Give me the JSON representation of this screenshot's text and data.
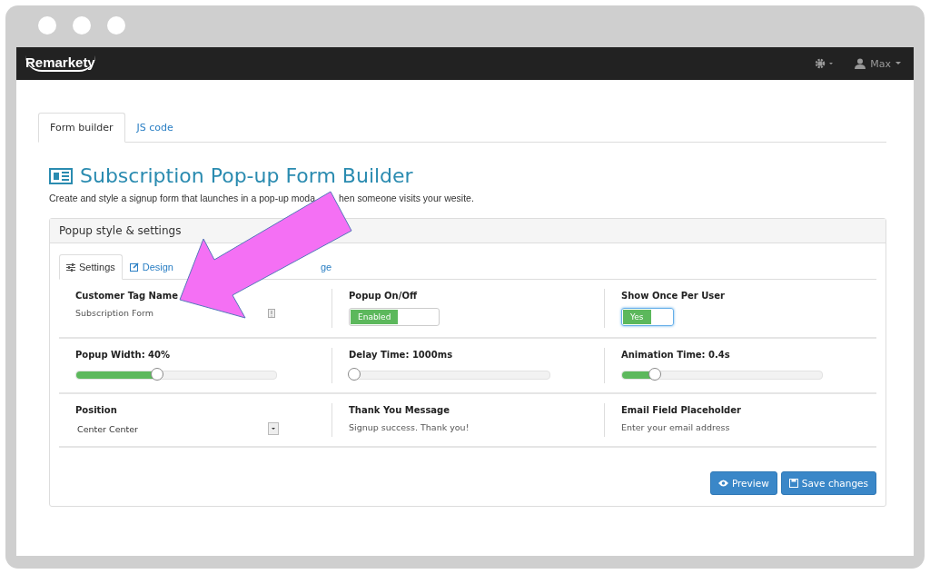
{
  "navbar": {
    "brand": "Remarkety",
    "user": "Max"
  },
  "tabs": [
    {
      "label": "Form builder",
      "selected": true
    },
    {
      "label": "JS code",
      "selected": false
    }
  ],
  "page": {
    "title": "Subscription Pop-up Form Builder",
    "subtitle_start": "Create and style a signup form that launches in a pop-up moda",
    "subtitle_end": "hen someone visits your wesite."
  },
  "panel": {
    "title": "Popup style & settings",
    "tabs": [
      {
        "label": "Settings",
        "selected": true
      },
      {
        "label": "Design",
        "selected": false
      },
      {
        "label": "ge",
        "selected": false
      }
    ],
    "rows": [
      [
        {
          "kind": "text",
          "label": "Customer Tag Name",
          "value": "Subscription Form"
        },
        {
          "kind": "toggle",
          "label": "Popup On/Off",
          "value": "Enabled",
          "on": true
        },
        {
          "kind": "toggle",
          "label": "Show Once Per User",
          "value": "Yes",
          "on": true
        }
      ],
      [
        {
          "kind": "slider",
          "label": "Popup Width: 40%",
          "level": 0.4
        },
        {
          "kind": "slider",
          "label": "Delay Time: 1000ms",
          "level": 0.02
        },
        {
          "kind": "slider",
          "label": "Animation Time: 0.4s",
          "level": 0.16
        }
      ],
      [
        {
          "kind": "select",
          "label": "Position",
          "value": "Center Center"
        },
        {
          "kind": "plain",
          "label": "Thank You Message",
          "value": "Signup success. Thank you!"
        },
        {
          "kind": "plain",
          "label": "Email Field Placeholder",
          "value": "Enter your email address"
        }
      ]
    ],
    "buttons": [
      "Preview",
      "Save changes"
    ]
  }
}
